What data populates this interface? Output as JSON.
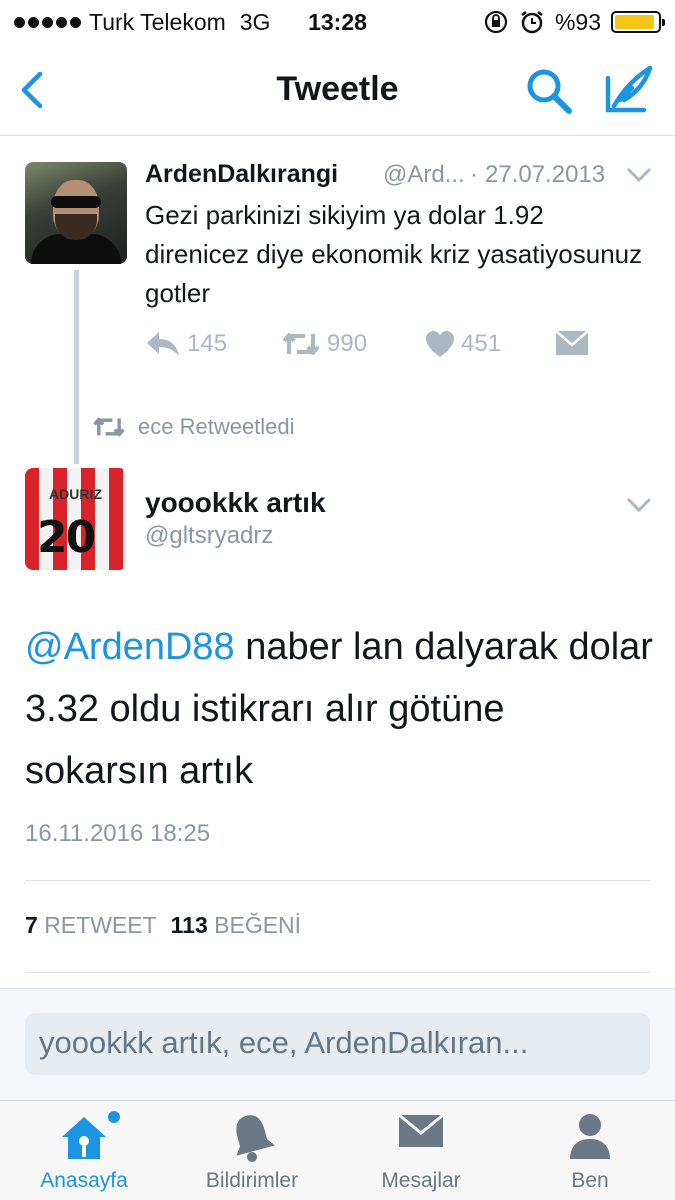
{
  "status_bar": {
    "carrier": "Turk Telekom",
    "network": "3G",
    "time": "13:28",
    "battery": "%93",
    "battery_level": 0.93
  },
  "nav": {
    "title": "Tweetle",
    "back_icon": "chevron-left-icon",
    "search_icon": "search-icon",
    "compose_icon": "compose-icon",
    "accent": "#1b95e0"
  },
  "parent_tweet": {
    "name": "ArdenDalkırangi",
    "handle": "@Ard...",
    "separator": "·",
    "date": "27.07.2013",
    "text": "Gezi parkinizi sikiyim ya dolar 1.92 direnicez diye ekonomik kriz yasatiyosunuz gotler",
    "replies": "145",
    "retweets": "990",
    "likes": "451"
  },
  "retweet_note": {
    "text": "ece Retweetledi"
  },
  "main_tweet": {
    "name": "yoookkk artık",
    "handle": "@gltsryadrz",
    "mention": "@ArdenD88",
    "text": " naber lan dalyarak dolar 3.32 oldu istikrarı alır götüne sokarsın artık",
    "timestamp": "16.11.2016 18:25",
    "avatar_jersey_name": "ADURIZ",
    "avatar_jersey_number": "20"
  },
  "stats": {
    "retweet_count": "7",
    "retweet_label": "RETWEET",
    "like_count": "113",
    "like_label": "BEĞENİ"
  },
  "reply": {
    "placeholder": "yoookkk artık, ece, ArdenDalkıran..."
  },
  "tabs": [
    {
      "label": "Anasayfa",
      "icon": "home-icon",
      "active": true
    },
    {
      "label": "Bildirimler",
      "icon": "bell-icon",
      "active": false
    },
    {
      "label": "Mesajlar",
      "icon": "envelope-icon",
      "active": false
    },
    {
      "label": "Ben",
      "icon": "person-icon",
      "active": false
    }
  ]
}
